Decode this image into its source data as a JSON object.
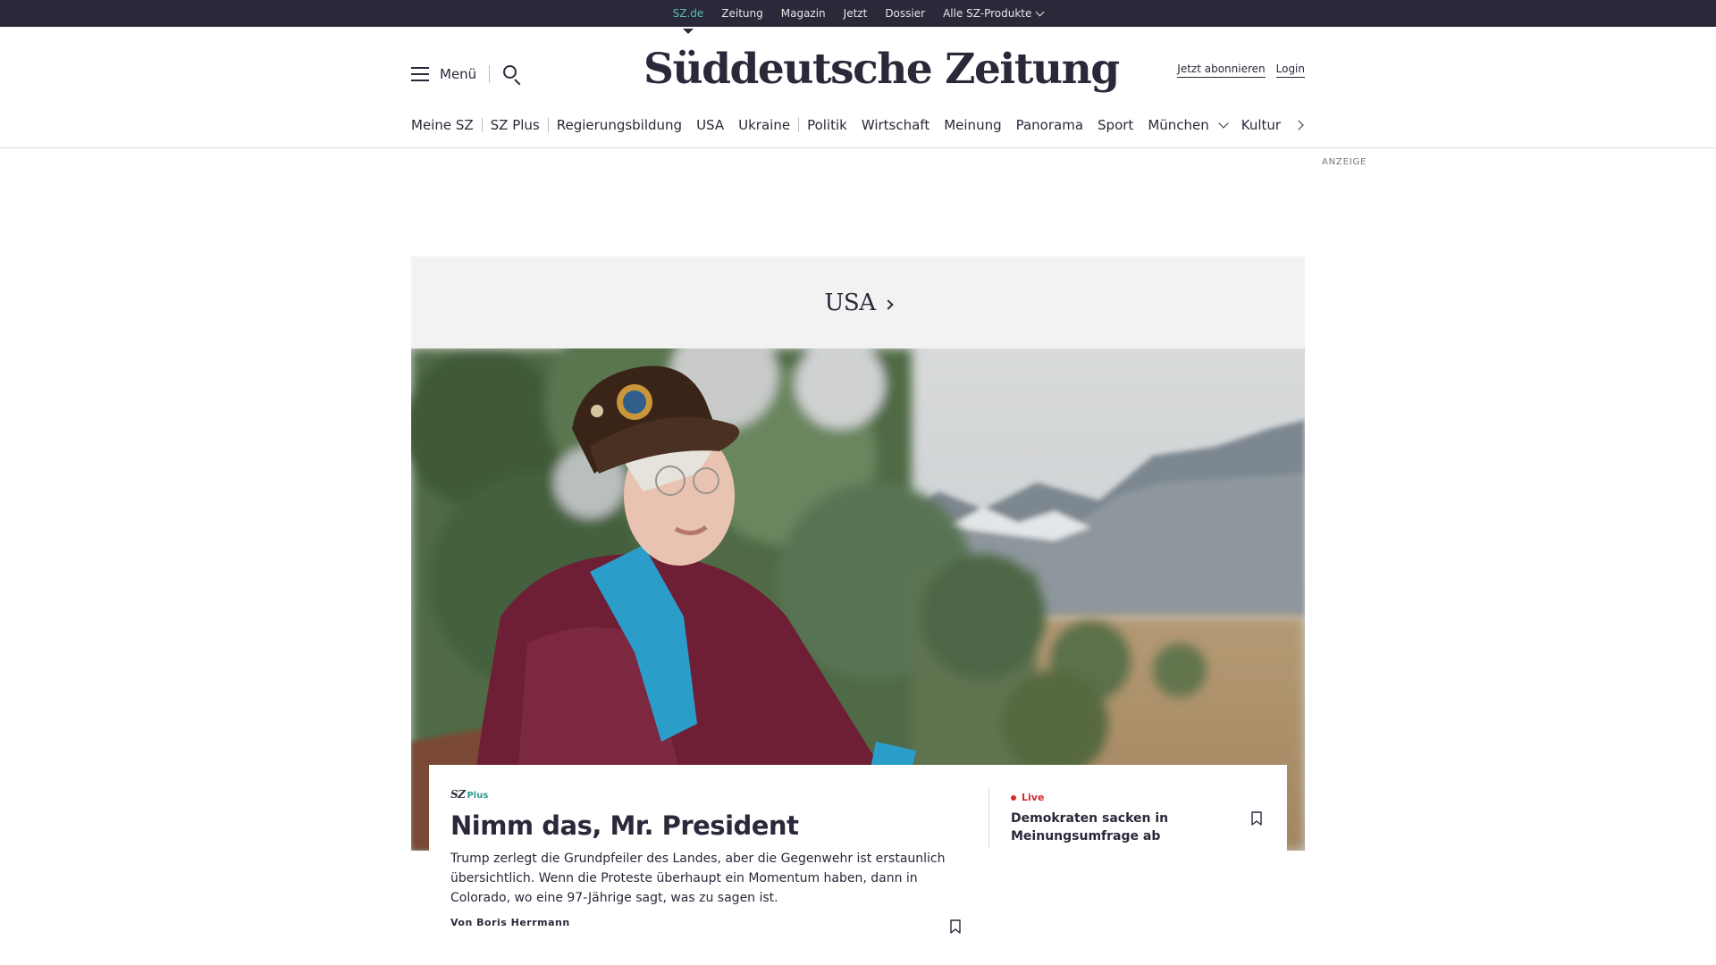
{
  "topbar": {
    "links": [
      {
        "label": "SZ.de",
        "active": true
      },
      {
        "label": "Zeitung"
      },
      {
        "label": "Magazin"
      },
      {
        "label": "Jetzt"
      },
      {
        "label": "Dossier"
      },
      {
        "label": "Alle SZ-Produkte",
        "dropdown": true
      }
    ]
  },
  "header": {
    "menu_label": "Menü",
    "search_icon": "search-icon",
    "logo_text": "Süddeutsche Zeitung",
    "subscribe_label": "Jetzt abonnieren",
    "login_label": "Login"
  },
  "catnav": {
    "items": [
      "Meine SZ",
      "SZ Plus",
      "Regierungsbildung",
      "USA",
      "Ukraine",
      "Politik",
      "Wirtschaft",
      "Meinung",
      "Panorama",
      "Sport",
      "München",
      "Kultur"
    ],
    "next_icon": "chevron-right-icon"
  },
  "ad": {
    "label": "ANZEIGE"
  },
  "section": {
    "title": "USA"
  },
  "teaser": {
    "badge_sz": "SZ",
    "badge_plus": "Plus",
    "headline": "Nimm das, Mr. President",
    "text": "Trump zerlegt die Grundpfeiler des Landes, aber die Gegenwehr ist erstaunlich übersichtlich. Wenn die Proteste überhaupt ein Momentum haben, dann in Colorado, wo eine 97-Jährige sagt, was zu sagen ist.",
    "author": "Von Boris Herrmann"
  },
  "side_story": {
    "live_label": "Live",
    "headline": "Demokraten sacken in Meinungsumfrage ab"
  },
  "colors": {
    "brand_dark": "#29293a",
    "accent_teal": "#2a9d8f",
    "live_red": "#d62a2a",
    "active_link": "#5fb8b0"
  }
}
